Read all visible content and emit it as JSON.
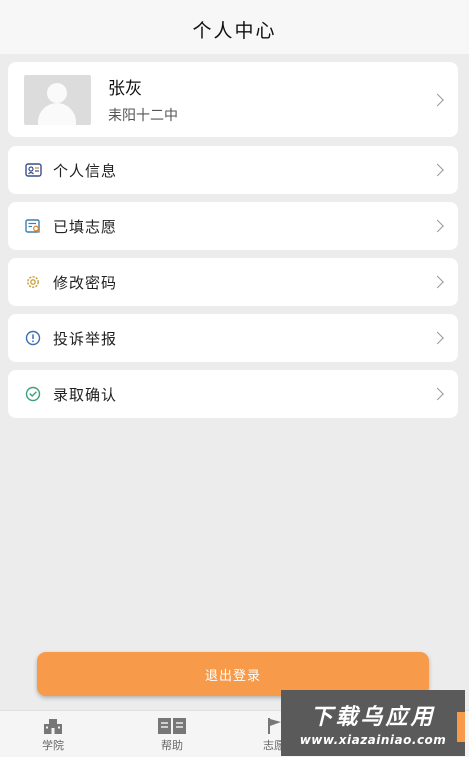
{
  "header": {
    "title": "个人中心"
  },
  "profile": {
    "name": "张灰",
    "school": "耒阳十二中"
  },
  "menu": [
    {
      "label": "个人信息",
      "icon": "id-card-icon",
      "color": "#3a4f8a"
    },
    {
      "label": "已填志愿",
      "icon": "document-search-icon",
      "color": "#3b7fb0"
    },
    {
      "label": "修改密码",
      "icon": "gear-icon",
      "color": "#c9a13b"
    },
    {
      "label": "投诉举报",
      "icon": "alert-circle-icon",
      "color": "#3b6fb0"
    },
    {
      "label": "录取确认",
      "icon": "check-circle-icon",
      "color": "#3aa37a"
    }
  ],
  "logout_label": "退出登录",
  "tabs": [
    {
      "label": "学院",
      "icon": "school-icon"
    },
    {
      "label": "帮助",
      "icon": "book-icon"
    },
    {
      "label": "志愿",
      "icon": "flag-icon"
    }
  ],
  "watermark": {
    "title": "下载乌应用",
    "url": "www.xiazainiao.com"
  },
  "colors": {
    "accent": "#f79a4a",
    "background": "#ececec"
  }
}
